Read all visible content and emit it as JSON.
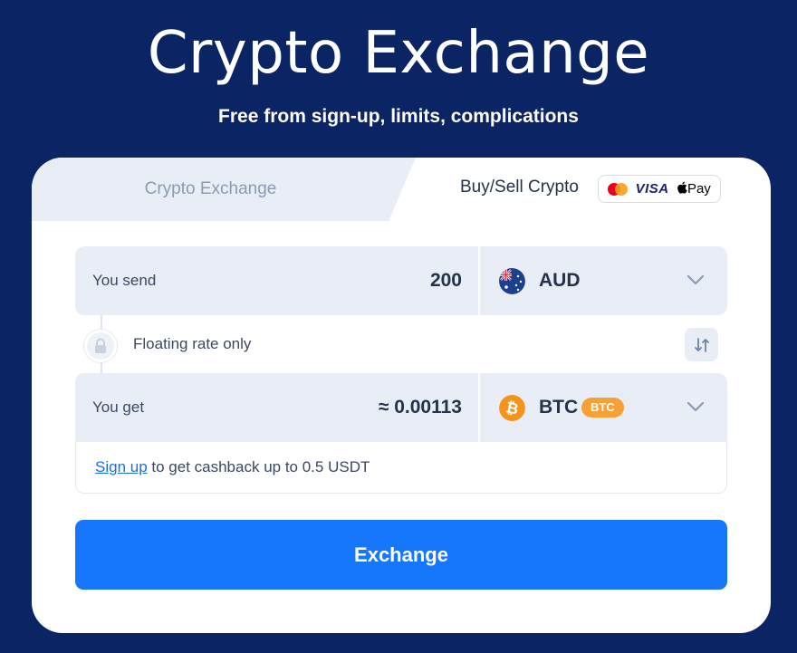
{
  "hero": {
    "title": "Crypto Exchange",
    "subtitle": "Free from sign-up, limits, complications"
  },
  "tabs": {
    "crypto_exchange": "Crypto Exchange",
    "buy_sell": "Buy/Sell Crypto",
    "payment_methods": [
      "mastercard-icon",
      "VISA",
      "Pay"
    ]
  },
  "send": {
    "label": "You send",
    "amount": "200",
    "currency": "AUD",
    "currency_icon": "australia-flag-icon"
  },
  "rate": {
    "text": "Floating rate only"
  },
  "get": {
    "label": "You get",
    "amount": "≈ 0.00113",
    "currency": "BTC",
    "network_badge": "BTC",
    "currency_icon": "bitcoin-icon"
  },
  "cashback": {
    "link_text": "Sign up",
    "text": " to get cashback up to 0.5 USDT"
  },
  "exchange_button": "Exchange",
  "colors": {
    "background": "#0b2463",
    "accent": "#1677fa",
    "bitcoin": "#f7931a",
    "badge": "#f7a035"
  }
}
